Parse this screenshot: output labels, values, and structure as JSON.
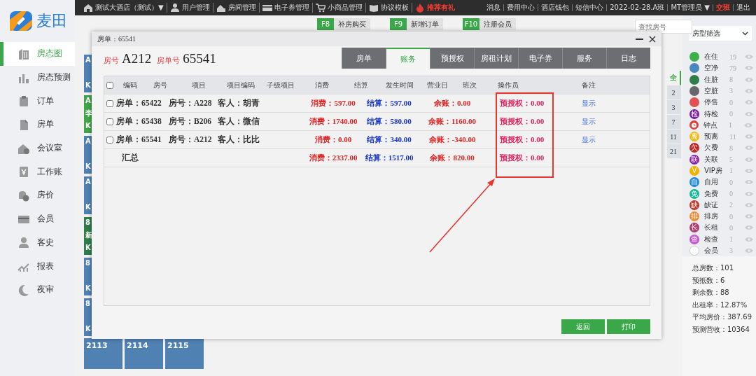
{
  "sidebar": {
    "logo": "麦田",
    "items": [
      {
        "label": "房态图",
        "selected": true,
        "kind": "building"
      },
      {
        "label": "房态预测",
        "selected": false,
        "kind": "bars"
      },
      {
        "label": "订单",
        "selected": false,
        "kind": "clipboard"
      },
      {
        "label": "房单",
        "selected": false,
        "kind": "document"
      },
      {
        "label": "会议室",
        "selected": false,
        "kind": "house"
      },
      {
        "label": "工作账",
        "selected": false,
        "kind": "ledger"
      },
      {
        "label": "房价",
        "selected": false,
        "kind": "coins"
      },
      {
        "label": "会员",
        "selected": false,
        "kind": "card"
      },
      {
        "label": "客史",
        "selected": false,
        "kind": "person"
      },
      {
        "label": "报表",
        "selected": false,
        "kind": "trend"
      },
      {
        "label": "夜审",
        "selected": false,
        "kind": "moon"
      }
    ]
  },
  "top_bar": {
    "hotel": "测试大酒店（测试）▼",
    "menu": [
      {
        "label": "用户管理",
        "kind": "user",
        "highlight": false
      },
      {
        "label": "房间管理",
        "kind": "house",
        "highlight": false
      },
      {
        "label": "电子券管理",
        "kind": "card",
        "highlight": false
      },
      {
        "label": "小商品管理",
        "kind": "cart",
        "highlight": false
      },
      {
        "label": "协议模板",
        "kind": "book",
        "highlight": false
      },
      {
        "label": "推荐有礼",
        "kind": "fire",
        "highlight": true
      }
    ],
    "right_links": [
      {
        "label": "消息",
        "highlight": false
      },
      {
        "label": "费用中心",
        "highlight": false
      },
      {
        "label": "酒店钱包",
        "highlight": false
      },
      {
        "label": "短信中心",
        "highlight": false
      },
      {
        "label": "2022-02-28.A班",
        "highlight": false
      },
      {
        "label": "MT管理员 ▼",
        "highlight": false
      },
      {
        "label": "交班",
        "highlight": true
      },
      {
        "label": "退出",
        "highlight": false
      }
    ]
  },
  "shortcuts": [
    {
      "key": "F8",
      "label": "补房购买"
    },
    {
      "key": "F9",
      "label": "新增订单"
    },
    {
      "key": "F10",
      "label": "注册会员"
    }
  ],
  "search": {
    "placeholder": "查找房号"
  },
  "room_tiles": [
    {
      "lines": [
        "A",
        "K"
      ],
      "color": "#4f81b3"
    },
    {
      "lines": [
        "A",
        "李",
        "K"
      ],
      "color": "#3fa548"
    },
    {
      "lines": [
        "A",
        "K"
      ],
      "color": "#4f81b3"
    },
    {
      "lines": [
        "A",
        "K"
      ],
      "color": "#4f81b3"
    },
    {
      "lines": [
        "8",
        "新",
        "K"
      ],
      "color": "#2e7d4a"
    },
    {
      "lines": [
        "8",
        "K"
      ],
      "color": "#4f81b3"
    },
    {
      "lines": [
        "8",
        "K"
      ],
      "color": "#4f81b3"
    }
  ],
  "bottom_tiles": [
    {
      "number": "2113"
    },
    {
      "number": "2114"
    },
    {
      "number": "2115"
    }
  ],
  "page_tabs": [
    {
      "label": "全",
      "selected": true
    },
    {
      "label": "2",
      "selected": false
    },
    {
      "label": "3",
      "selected": false
    },
    {
      "label": "7",
      "selected": false
    },
    {
      "label": "11",
      "selected": false
    },
    {
      "label": "21",
      "selected": false
    }
  ],
  "room_type_filter": {
    "value": "房型筛选"
  },
  "legend": [
    {
      "label": "在住",
      "count": "19",
      "kind": "dot",
      "color": "#3cb04a"
    },
    {
      "label": "空净",
      "count": "79",
      "kind": "dot",
      "color": "#4a86c0"
    },
    {
      "label": "住脏",
      "count": "8",
      "kind": "dot",
      "color": "#2e7d4a"
    },
    {
      "label": "空脏",
      "count": "3",
      "kind": "dot",
      "color": "#66666b"
    },
    {
      "label": "停售",
      "count": "0",
      "kind": "dot",
      "color": "#e05252"
    },
    {
      "label": "待检",
      "count": "0",
      "kind": "badge",
      "glyph": "检",
      "color": "#7b1fa2"
    },
    {
      "label": "钟点",
      "count": "1",
      "kind": "clock",
      "color": "#e53935"
    },
    {
      "label": "预离",
      "count": "11",
      "kind": "badge",
      "glyph": "离",
      "color": "#f2b90c"
    },
    {
      "label": "欠费",
      "count": "8",
      "kind": "badge",
      "glyph": "欠",
      "color": "#c62828"
    },
    {
      "label": "关联",
      "count": "5",
      "kind": "badge",
      "glyph": "联",
      "color": "#8e24aa"
    },
    {
      "label": "VIP房",
      "count": "1",
      "kind": "badge",
      "glyph": "V",
      "color": "#f5b000"
    },
    {
      "label": "自用",
      "count": "0",
      "kind": "badge",
      "glyph": "自",
      "color": "#1e88e5"
    },
    {
      "label": "免费",
      "count": "0",
      "kind": "badge",
      "glyph": "免",
      "color": "#17b897"
    },
    {
      "label": "缺证",
      "count": "2",
      "kind": "badge",
      "glyph": "缺",
      "color": "#c0392b"
    },
    {
      "label": "排房",
      "count": "0",
      "kind": "badge",
      "glyph": "排",
      "color": "#f08a30"
    },
    {
      "label": "长租",
      "count": "0",
      "kind": "badge",
      "glyph": "长",
      "color": "#b03a6e"
    },
    {
      "label": "检查",
      "count": "1",
      "kind": "badge",
      "glyph": "查",
      "color": "#c653d6"
    },
    {
      "label": "会员",
      "count": "3",
      "kind": "ring",
      "color": "#ffffff"
    }
  ],
  "stats": [
    "总房数：101",
    "预抵数：6",
    "剩余数：88",
    "出租率：12.87%",
    "平均房价：387.69",
    "预测营收：10364"
  ],
  "modal": {
    "title": "房单：65541",
    "room_label": "房号",
    "room": "A212",
    "bill_label": "房单号",
    "bill": "65541",
    "tabs": [
      {
        "label": "房单",
        "selected": false
      },
      {
        "label": "账务",
        "selected": true
      },
      {
        "label": "预授权",
        "selected": false
      },
      {
        "label": "房租计划",
        "selected": false
      },
      {
        "label": "电子券",
        "selected": false
      },
      {
        "label": "服务",
        "selected": false
      },
      {
        "label": "日志",
        "selected": false
      }
    ],
    "select_all": {
      "checked": false
    },
    "columns": [
      "编码",
      "房号",
      "项目",
      "项目编码",
      "子级项目",
      "消费",
      "结算",
      "发生时间",
      "营业日",
      "班次",
      "操作员",
      "备注"
    ],
    "rows": [
      {
        "checked": false,
        "bill": "房单：65422",
        "room": "房号：A228",
        "guest": "客人：胡青",
        "consume": "消费：597.00",
        "settle": "结算：597.00",
        "balance": "余账：0.00",
        "preauth": "预授权：0.00",
        "note": "显示"
      },
      {
        "checked": false,
        "bill": "房单：65438",
        "room": "房号：B206",
        "guest": "客人：微信",
        "consume": "消费：1740.00",
        "settle": "结算：580.00",
        "balance": "余账：1160.00",
        "preauth": "预授权：0.00",
        "note": "显示"
      },
      {
        "checked": false,
        "bill": "房单：65541",
        "room": "房号：A212",
        "guest": "客人：比比",
        "consume": "消费：0.00",
        "settle": "结算：340.00",
        "balance": "余账：-340.00",
        "preauth": "预授权：0.00",
        "note": "显示"
      }
    ],
    "total": {
      "label": "汇总",
      "consume": "消费：2337.00",
      "settle": "结算：1517.00",
      "balance": "余账：820.00",
      "preauth": "预授权：0.00"
    },
    "buttons": [
      {
        "label": "返回"
      },
      {
        "label": "打印"
      }
    ]
  }
}
